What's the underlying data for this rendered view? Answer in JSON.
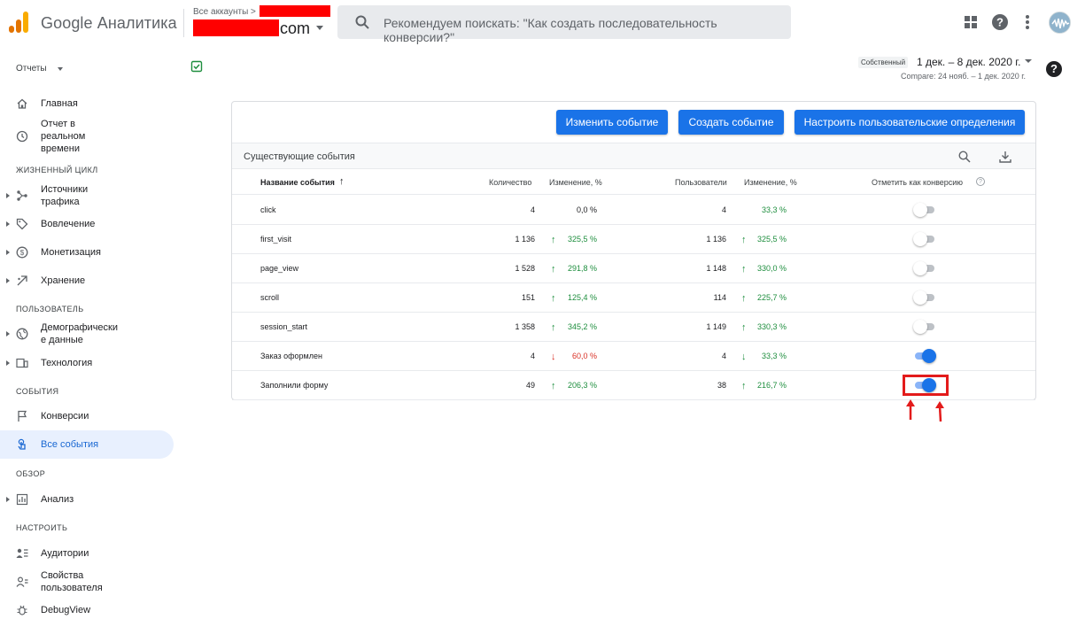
{
  "app": {
    "brand": "Google Аналитика",
    "account_breadcrumb": "Все аккаунты >",
    "account_domain": "com",
    "search_placeholder": "Рекомендуем поискать: \"Как создать последовательность конверсии?\""
  },
  "colors": {
    "accent": "#1a73e8",
    "positive": "#1e8e3e",
    "negative": "#d93025",
    "redaction": "#ff0000",
    "annotation": "#e31b1b"
  },
  "sidebar": {
    "reports_label": "Отчеты",
    "items_top": [
      {
        "label": "Главная",
        "icon": "home-icon"
      },
      {
        "label": "Отчет в реальном времени",
        "icon": "clock-icon"
      }
    ],
    "sections": [
      {
        "header": "ЖИЗНЕННЫЙ ЦИКЛ",
        "items": [
          {
            "label": "Источники трафика",
            "icon": "source-icon"
          },
          {
            "label": "Вовлечение",
            "icon": "tag-icon"
          },
          {
            "label": "Монетизация",
            "icon": "dollar-icon"
          },
          {
            "label": "Хранение",
            "icon": "retention-icon"
          }
        ]
      },
      {
        "header": "ПОЛЬЗОВАТЕЛЬ",
        "items": [
          {
            "label": "Демографические данные",
            "icon": "globe-icon"
          },
          {
            "label": "Технология",
            "icon": "device-icon"
          }
        ]
      },
      {
        "header": "СОБЫТИЯ",
        "items": [
          {
            "label": "Конверсии",
            "icon": "flag-icon"
          },
          {
            "label": "Все события",
            "icon": "touch-icon",
            "active": true
          }
        ]
      },
      {
        "header": "ОБЗОР",
        "items": [
          {
            "label": "Анализ",
            "icon": "analysis-icon"
          }
        ]
      },
      {
        "header": "НАСТРОИТЬ",
        "items": [
          {
            "label": "Аудитории",
            "icon": "audience-icon"
          },
          {
            "label": "Свойства пользователя",
            "icon": "user-props-icon"
          },
          {
            "label": "DebugView",
            "icon": "debug-icon"
          }
        ]
      }
    ],
    "labels": {
      "home": "Главная",
      "realtime_1": "Отчет в",
      "realtime_2": "реальном",
      "realtime_3": "времени",
      "lifecycle": "ЖИЗНЕННЫЙ ЦИКЛ",
      "traffic_1": "Источники",
      "traffic_2": "трафика",
      "engagement": "Вовлечение",
      "monetization": "Монетизация",
      "retention": "Хранение",
      "user_section": "ПОЛЬЗОВАТЕЛЬ",
      "demo_1": "Демографически",
      "demo_2": "е данные",
      "tech": "Технология",
      "events_section": "СОБЫТИЯ",
      "conversions": "Конверсии",
      "all_events": "Все события",
      "overview_section": "ОБЗОР",
      "analysis": "Анализ",
      "configure_section": "НАСТРОИТЬ",
      "audiences": "Аудитории",
      "userprops_1": "Свойства",
      "userprops_2": "пользователя",
      "debugview": "DebugView"
    }
  },
  "date": {
    "chip": "Собственный",
    "range": "1 дек. – 8 дек. 2020 г.",
    "compare": "Compare: 24 нояб. – 1 дек. 2020 г."
  },
  "card": {
    "buttons": {
      "edit_event": "Изменить событие",
      "create_event": "Создать событие",
      "custom_definitions": "Настроить пользовательские определения"
    },
    "section_title": "Существующие события",
    "columns": {
      "event_name": "Название события",
      "sort_arrow": "↑",
      "count": "Количество",
      "count_change": "Изменение, %",
      "users": "Пользователи",
      "users_change": "Изменение, %",
      "mark_conversion": "Отметить как конверсию"
    },
    "rows": [
      {
        "name": "click",
        "count": "4",
        "count_change": "0,0 %",
        "count_dir": "none",
        "users": "4",
        "users_change": "33,3 %",
        "users_dir": "none",
        "conversion": false
      },
      {
        "name": "first_visit",
        "count": "1 136",
        "count_change": "325,5 %",
        "count_dir": "up",
        "users": "1 136",
        "users_change": "325,5 %",
        "users_dir": "up",
        "conversion": false
      },
      {
        "name": "page_view",
        "count": "1 528",
        "count_change": "291,8 %",
        "count_dir": "up",
        "users": "1 148",
        "users_change": "330,0 %",
        "users_dir": "up",
        "conversion": false
      },
      {
        "name": "scroll",
        "count": "151",
        "count_change": "125,4 %",
        "count_dir": "up",
        "users": "114",
        "users_change": "225,7 %",
        "users_dir": "up",
        "conversion": false
      },
      {
        "name": "session_start",
        "count": "1 358",
        "count_change": "345,2 %",
        "count_dir": "up",
        "users": "1 149",
        "users_change": "330,3 %",
        "users_dir": "up",
        "conversion": false
      },
      {
        "name": "Заказ оформлен",
        "count": "4",
        "count_change": "60,0 %",
        "count_dir": "down",
        "users": "4",
        "users_change": "33,3 %",
        "users_dir": "down",
        "conversion": true
      },
      {
        "name": "Заполнили форму",
        "count": "49",
        "count_change": "206,3 %",
        "count_dir": "up",
        "users": "38",
        "users_change": "216,7 %",
        "users_dir": "up",
        "conversion": true
      }
    ],
    "glyphs": {
      "up": "↑",
      "down": "↓",
      "help": "?"
    }
  }
}
